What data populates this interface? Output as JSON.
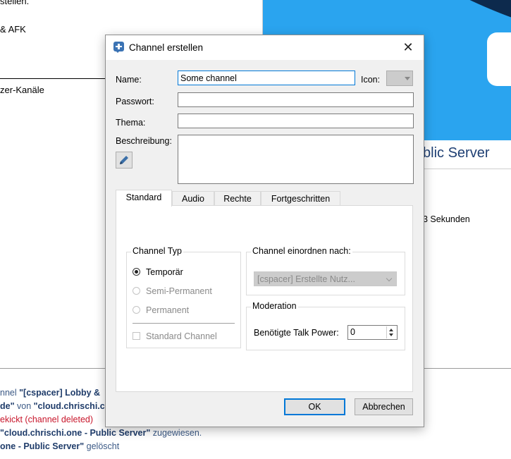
{
  "background": {
    "left_lines": [
      "stellen.",
      "& AFK",
      "zer-Kanäle"
    ],
    "server_title": "blic Server",
    "info": "3 Sekunden",
    "log": [
      {
        "pre": "nnel ",
        "bold": "\"[cspacer] Lobby &",
        "post": ""
      },
      {
        "pre": "",
        "bold": "de\"",
        "mid": " von ",
        "bold2": "\"cloud.chrischi.c",
        "post": ""
      },
      {
        "red": "ekickt (channel deleted)"
      },
      {
        "bold": "\"cloud.chrischi.one - Public Server\"",
        "post": " zugewiesen."
      },
      {
        "bold": "one - Public Server\"",
        "post": " gelöscht"
      }
    ]
  },
  "dialog": {
    "title": "Channel erstellen",
    "close_glyph": "✕",
    "fields": {
      "name_label": "Name:",
      "name_value": "Some channel",
      "icon_label": "Icon:",
      "password_label": "Passwort:",
      "password_value": "",
      "topic_label": "Thema:",
      "topic_value": "",
      "description_label": "Beschreibung:",
      "description_value": ""
    },
    "tabs": [
      "Standard",
      "Audio",
      "Rechte",
      "Fortgeschritten"
    ],
    "active_tab": "Standard",
    "channel_type": {
      "title": "Channel Typ",
      "options": [
        {
          "label": "Temporär",
          "checked": true,
          "enabled": true
        },
        {
          "label": "Semi-Permanent",
          "checked": false,
          "enabled": false
        },
        {
          "label": "Permanent",
          "checked": false,
          "enabled": false
        }
      ],
      "default_channel_label": "Standard Channel"
    },
    "sort": {
      "title": "Channel einordnen nach:",
      "selected": "[cspacer] Erstellte Nutz..."
    },
    "moderation": {
      "title": "Moderation",
      "talk_power_label": "Benötigte Talk Power:",
      "talk_power_value": "0"
    },
    "buttons": {
      "ok": "OK",
      "cancel": "Abbrechen"
    }
  },
  "colors": {
    "accent": "#0078d7",
    "server_title": "#1e3f73",
    "log_red": "#c8162b"
  }
}
